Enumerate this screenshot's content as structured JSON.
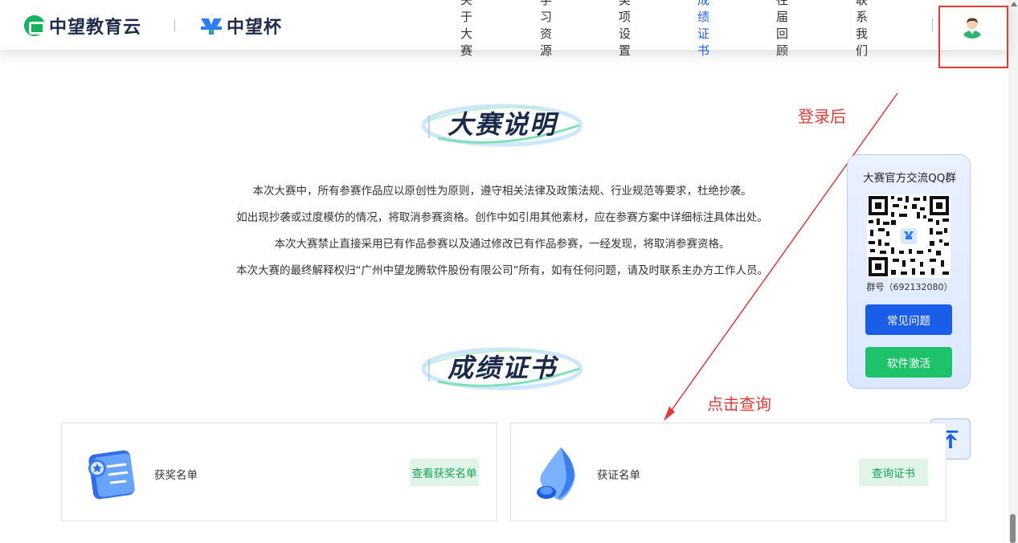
{
  "header": {
    "brand_primary": "中望教育云",
    "brand_secondary": "中望杯",
    "nav": [
      {
        "label": "关于大赛",
        "active": false
      },
      {
        "label": "学习资源",
        "active": false
      },
      {
        "label": "奖项设置",
        "active": false
      },
      {
        "label": "成绩证书",
        "active": true
      },
      {
        "label": "往届回顾",
        "active": false
      },
      {
        "label": "联系我们",
        "active": false
      }
    ],
    "avatar_icon": "user-avatar-icon"
  },
  "sections": {
    "description_title": "大赛说明",
    "description_lines": [
      "本次大赛中，所有参赛作品应以原创性为原则，遵守相关法律及政策法规、行业规范等要求，杜绝抄袭。",
      "如出现抄袭或过度模仿的情况，将取消参赛资格。创作中如引用其他素材，应在参赛方案中详细标注具体出处。",
      "本次大赛禁止直接采用已有作品参赛以及通过修改已有作品参赛，一经发现，将取消参赛资格。",
      "本次大赛的最终解释权归“广州中望龙腾软件股份有限公司”所有，如有任何问题，请及时联系主办方工作人员。"
    ],
    "certificate_title": "成绩证书"
  },
  "annotations": {
    "after_login": "登录后",
    "click_query": "点击查询"
  },
  "qq_panel": {
    "title": "大赛官方交流QQ群",
    "group_number": "群号（692132080）",
    "faq_button": "常见问题",
    "activate_button": "软件激活"
  },
  "cards": [
    {
      "label": "获奖名单",
      "button": "查看获奖名单",
      "icon": "award-scroll-icon"
    },
    {
      "label": "获证名单",
      "button": "查询证书",
      "icon": "megaphone-icon"
    }
  ],
  "colors": {
    "accent_blue": "#1c64f2",
    "annotation_red": "#e53935",
    "green_button": "#1ec26a",
    "navy_text": "#1b2a4a"
  }
}
